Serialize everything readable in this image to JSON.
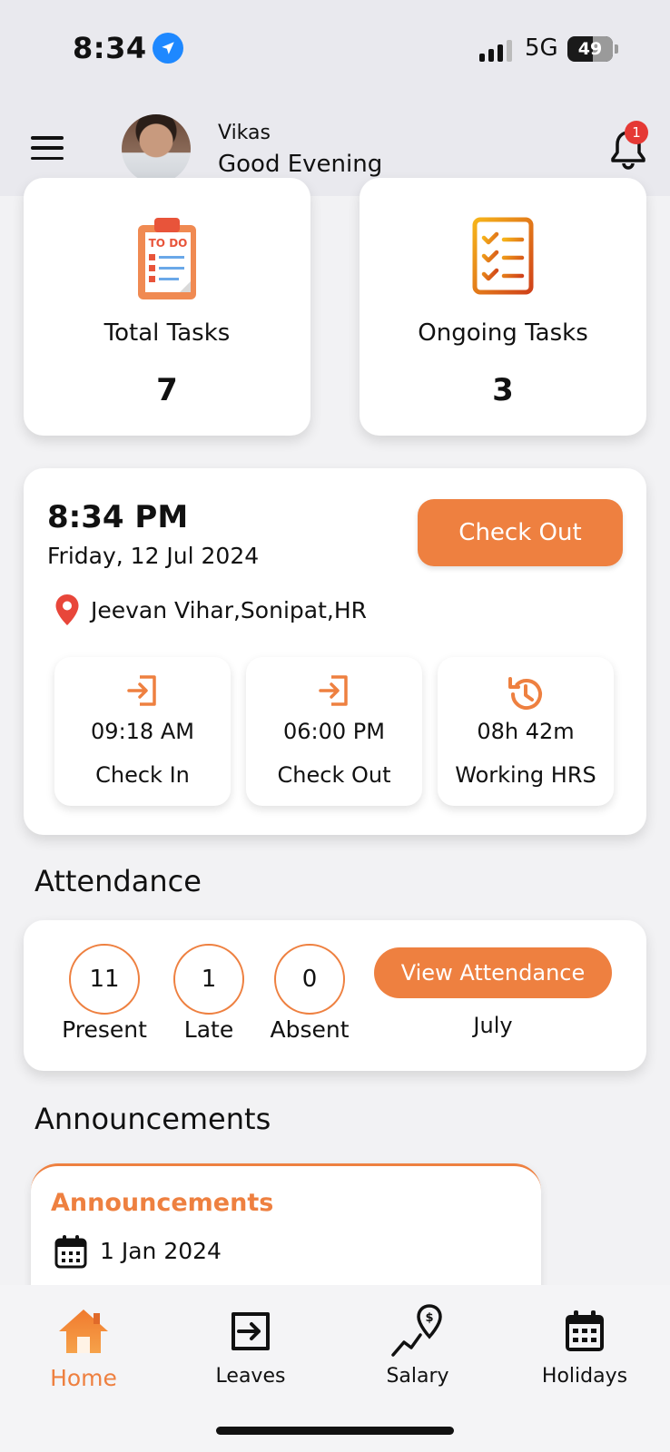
{
  "status_bar": {
    "time": "8:34",
    "network": "5G",
    "battery": "49"
  },
  "header": {
    "user_name": "Vikas",
    "greeting": "Good Evening",
    "notification_count": "1"
  },
  "tasks": {
    "total": {
      "label": "Total Tasks",
      "value": "7",
      "icon_text": "TO DO"
    },
    "ongoing": {
      "label": "Ongoing Tasks",
      "value": "3"
    }
  },
  "attendance_today": {
    "time": "8:34 PM",
    "date": "Friday, 12 Jul 2024",
    "check_out_label": "Check Out",
    "location": "Jeevan Vihar,Sonipat,HR",
    "stats": [
      {
        "value": "09:18 AM",
        "label": "Check In"
      },
      {
        "value": "06:00 PM",
        "label": "Check Out"
      },
      {
        "value": "08h 42m",
        "label": "Working HRS"
      }
    ]
  },
  "attendance_summary": {
    "title": "Attendance",
    "present": {
      "value": "11",
      "label": "Present"
    },
    "late": {
      "value": "1",
      "label": "Late"
    },
    "absent": {
      "value": "0",
      "label": "Absent"
    },
    "view_label": "View Attendance",
    "month": "July"
  },
  "announcements": {
    "title": "Announcements",
    "card_title": "Announcements",
    "date": "1 Jan 2024"
  },
  "nav": {
    "home": "Home",
    "leaves": "Leaves",
    "salary": "Salary",
    "holidays": "Holidays"
  },
  "colors": {
    "accent": "#ee8040",
    "badge": "#e53935",
    "location_badge": "#1e88ff"
  }
}
